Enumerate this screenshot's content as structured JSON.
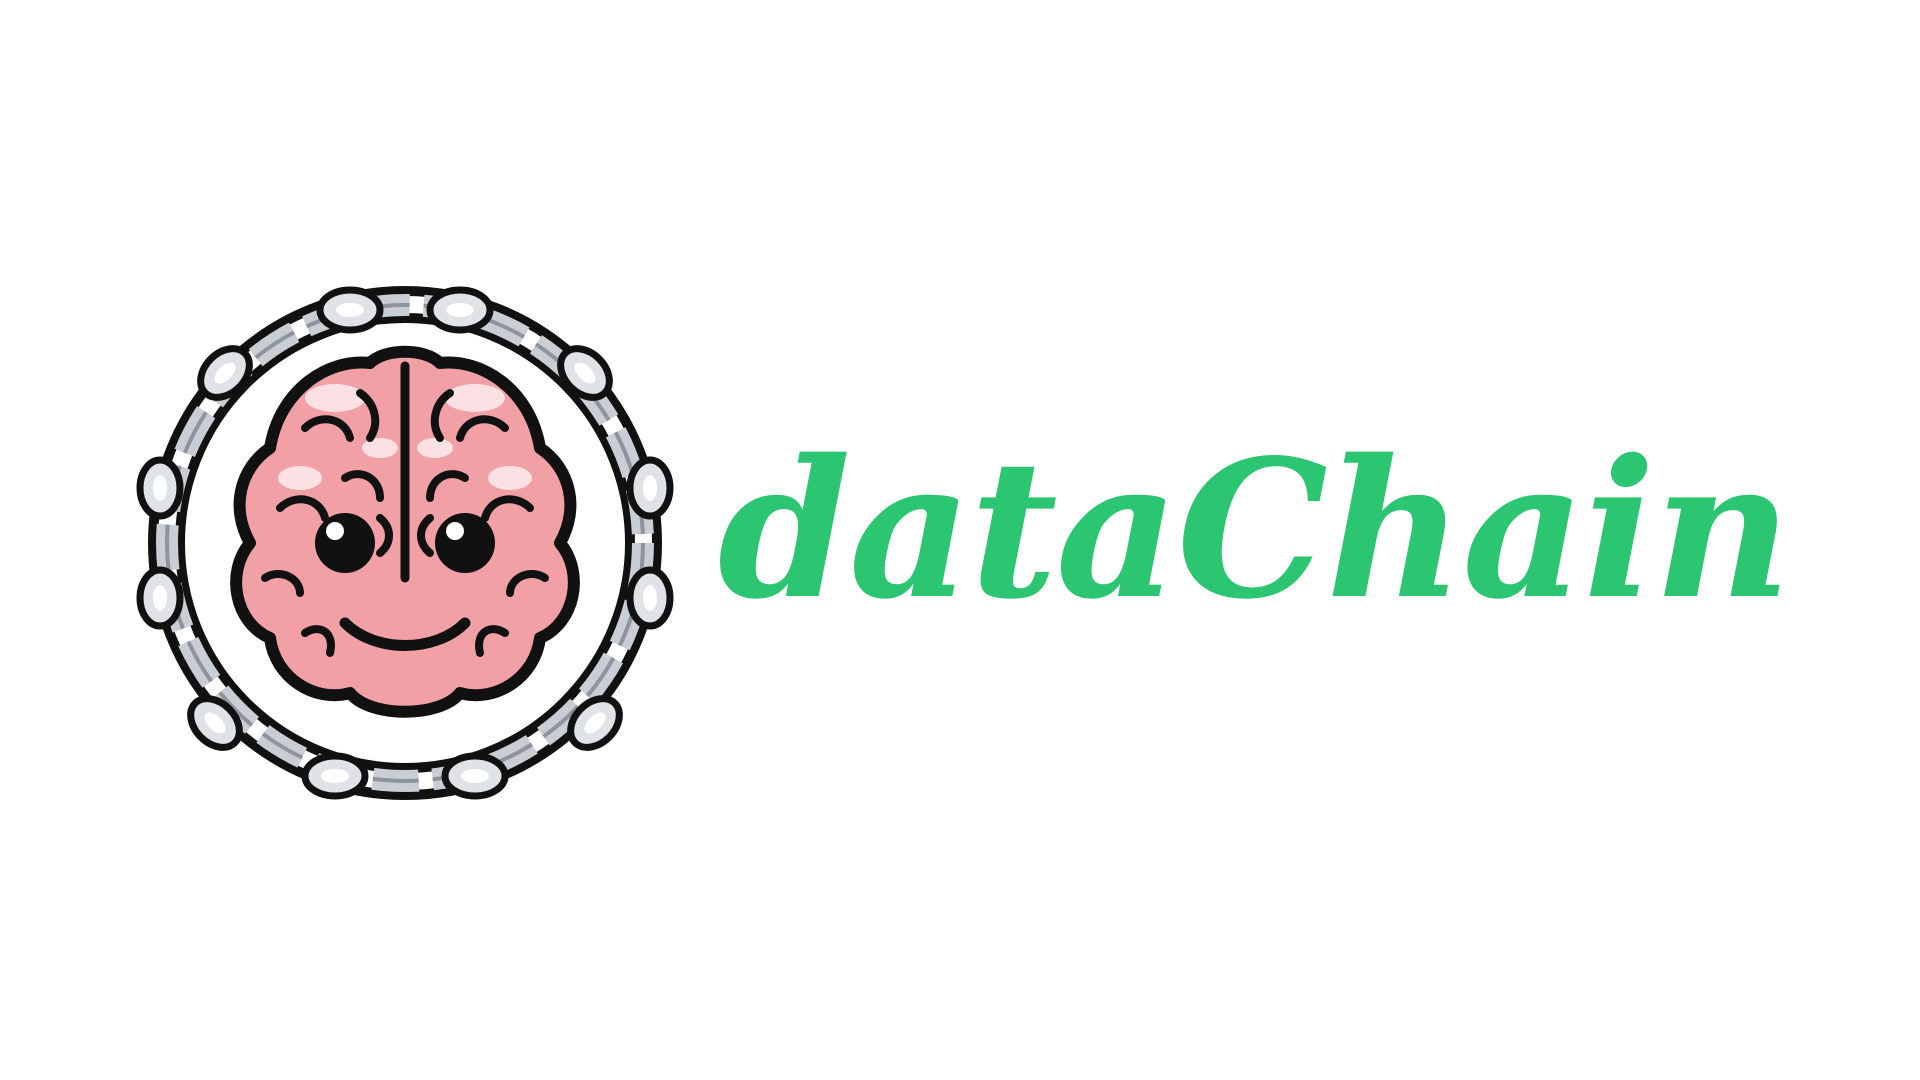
{
  "brand": {
    "name": "dataChain",
    "text_color": "#2cc672"
  },
  "logo": {
    "icon": "brain-in-chain-icon",
    "brain_color": "#f1a0a6",
    "brain_highlight_color": "#fbe1e3",
    "chain_color": "#c9ced4",
    "outline_color": "#111111"
  },
  "page": {
    "background_color": "#ffffff"
  }
}
